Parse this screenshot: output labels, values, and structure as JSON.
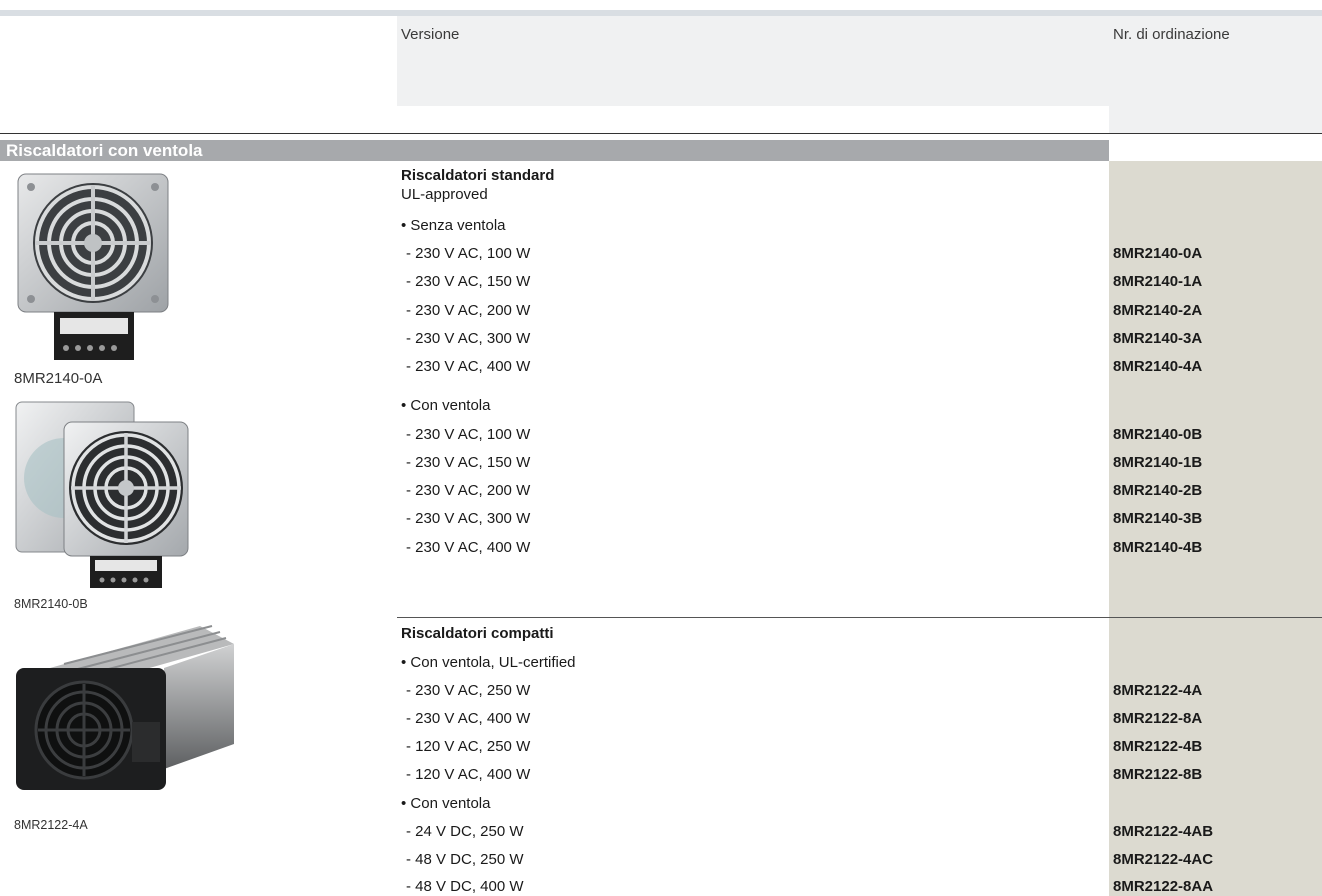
{
  "header": {
    "col_version": "Versione",
    "col_order": "Nr. di ordinazione"
  },
  "section": {
    "title": "Riscaldatori con ventola"
  },
  "images": {
    "img1_caption": "8MR2140-0A",
    "img2_caption": "8MR2140-0B",
    "img3_caption": "8MR2122-4A"
  },
  "group_standard": {
    "title": "Riscaldatori standard",
    "subtitle": "UL-approved",
    "sub1": {
      "label": "• Senza ventola",
      "rows": [
        {
          "desc": "- 230 V AC, 100 W",
          "code": "8MR2140-0A"
        },
        {
          "desc": "- 230 V AC, 150 W",
          "code": "8MR2140-1A"
        },
        {
          "desc": "- 230 V AC, 200 W",
          "code": "8MR2140-2A"
        },
        {
          "desc": "- 230 V AC, 300 W",
          "code": "8MR2140-3A"
        },
        {
          "desc": "- 230 V AC, 400 W",
          "code": "8MR2140-4A"
        }
      ]
    },
    "sub2": {
      "label": "• Con ventola",
      "rows": [
        {
          "desc": "- 230 V AC, 100 W",
          "code": "8MR2140-0B"
        },
        {
          "desc": "- 230 V AC, 150 W",
          "code": "8MR2140-1B"
        },
        {
          "desc": "- 230 V AC, 200 W",
          "code": "8MR2140-2B"
        },
        {
          "desc": "- 230 V AC, 300 W",
          "code": "8MR2140-3B"
        },
        {
          "desc": "- 230 V AC, 400 W",
          "code": "8MR2140-4B"
        }
      ]
    }
  },
  "group_compact": {
    "title": "Riscaldatori compatti",
    "sub1": {
      "label": "• Con ventola, UL-certified",
      "rows": [
        {
          "desc": "- 230 V AC, 250 W",
          "code": "8MR2122-4A"
        },
        {
          "desc": "- 230 V AC, 400 W",
          "code": "8MR2122-8A"
        },
        {
          "desc": "- 120 V AC, 250 W",
          "code": "8MR2122-4B"
        },
        {
          "desc": "- 120 V AC, 400 W",
          "code": "8MR2122-8B"
        }
      ]
    },
    "sub2": {
      "label": "• Con ventola",
      "rows": [
        {
          "desc": "- 24 V DC, 250 W",
          "code": "8MR2122-4AB"
        },
        {
          "desc": "- 48 V DC, 250 W",
          "code": "8MR2122-4AC"
        },
        {
          "desc": "- 48 V DC, 400 W",
          "code": "8MR2122-8AA"
        }
      ]
    }
  }
}
